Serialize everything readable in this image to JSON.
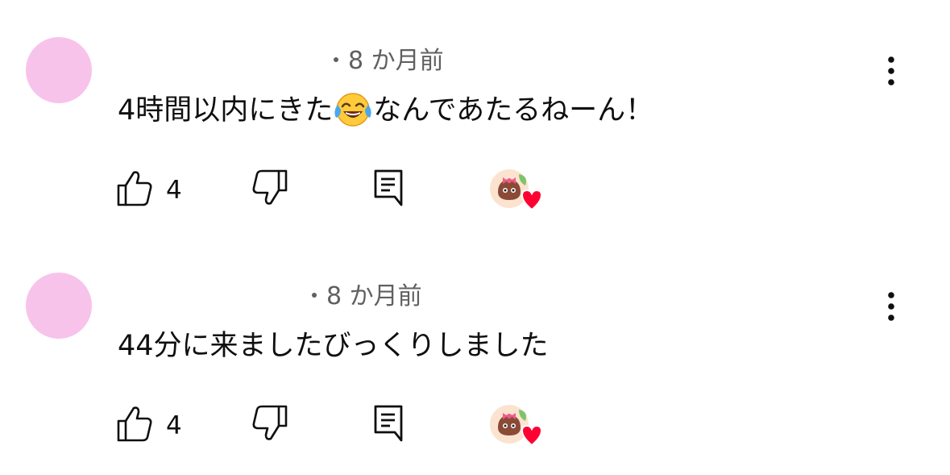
{
  "comments": [
    {
      "time": "8 か月前",
      "text_before_emoji": "4時間以内にきた",
      "emoji": "face-with-tears-of-joy",
      "text_after_emoji": "なんであたるねーん！",
      "like_count": "4",
      "avatar_color": "#f8c3ea"
    },
    {
      "time": "8 か月前",
      "text": "44分に来ましたびっくりしました",
      "like_count": "4",
      "avatar_color": "#f8c3ea"
    }
  ],
  "icons": {
    "like": "thumb-up-icon",
    "dislike": "thumb-down-icon",
    "reply": "comment-icon",
    "more": "more-vert-icon",
    "heart": "creator-heart-icon"
  },
  "colors": {
    "meta_text": "#606060",
    "primary_text": "#0f0f0f",
    "heart": "#ff0033"
  }
}
